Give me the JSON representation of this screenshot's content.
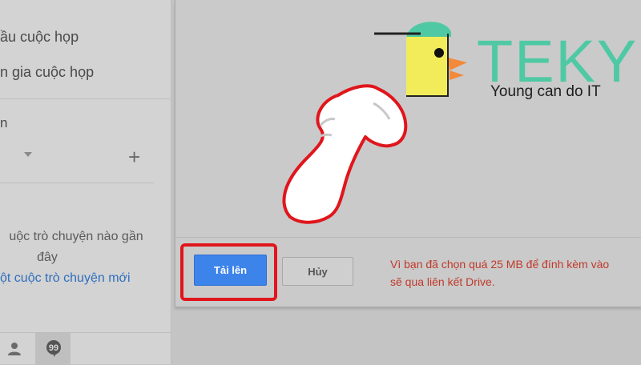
{
  "sidebar": {
    "item_start_meeting": "ầu cuộc họp",
    "item_join_meeting": "n gia cuộc họp",
    "heading": "n",
    "empty_line1": "uộc trò chuyện nào gần",
    "empty_line2": "đây",
    "new_chat_link": "ột cuộc trò chuyện mới",
    "icons": [
      "person-icon",
      "quote-bubble-icon"
    ]
  },
  "dialog": {
    "upload_label": "Tải lên",
    "cancel_label": "Hủy",
    "warning_line1": "Vì bạn đã chọn quá 25 MB để đính kèm vào",
    "warning_line2": "sẽ qua liên kết Drive."
  },
  "logo": {
    "brand": "TEKY",
    "tagline": "Young can do IT"
  },
  "colors": {
    "upload_blue": "#3d84ea",
    "highlight_red": "#e0161c",
    "warning_red": "#c0392b",
    "link_blue": "#2f6fbe",
    "logo_teal": "#4fc9a3",
    "logo_yellow": "#f2ec5a",
    "logo_orange": "#f28a3a"
  }
}
